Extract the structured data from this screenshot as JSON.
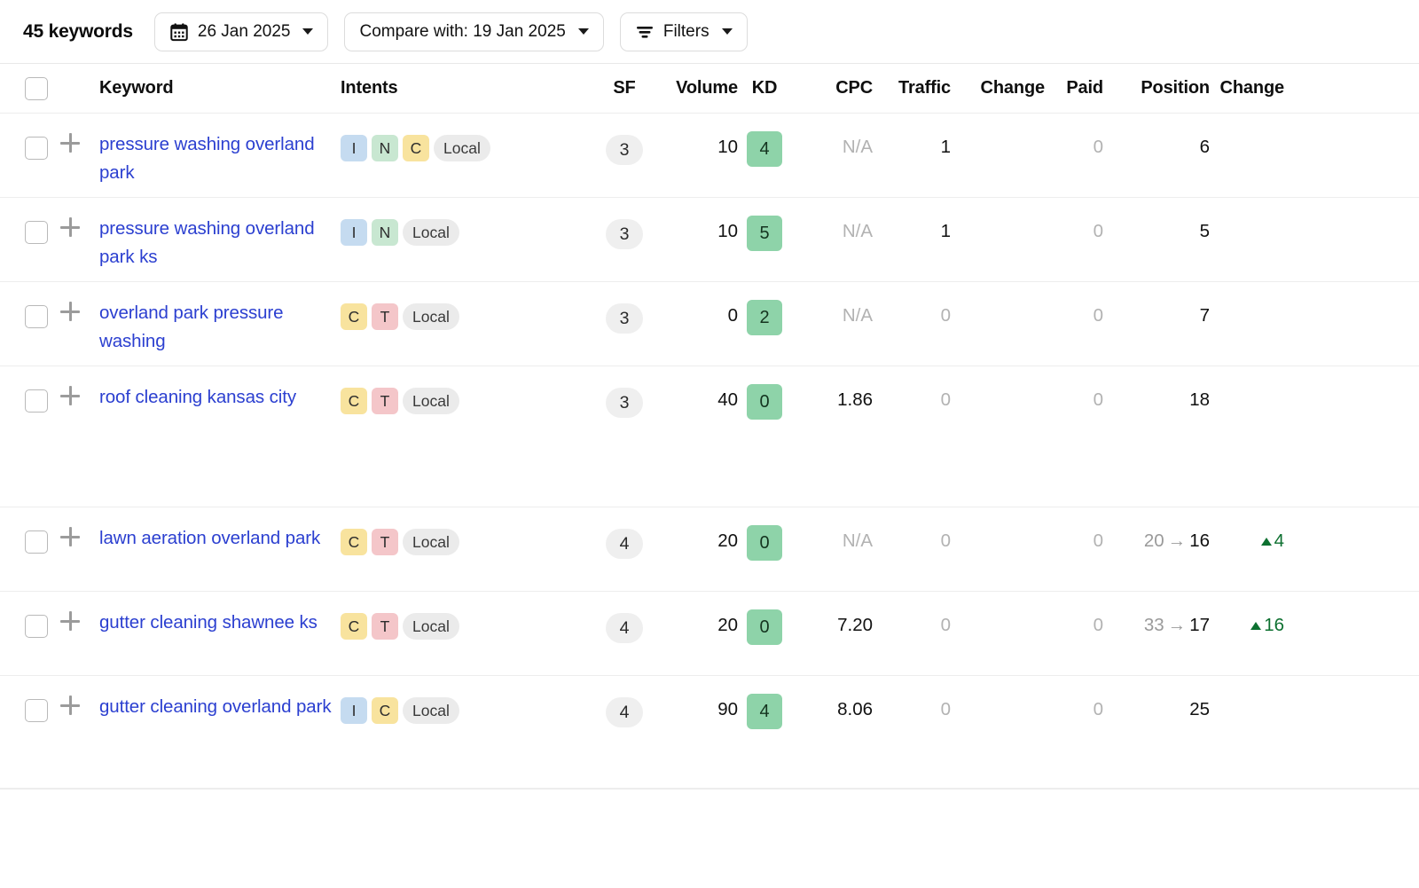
{
  "toolbar": {
    "keyword_count_label": "45 keywords",
    "date_button": {
      "label": "26 Jan 2025",
      "icon": "calendar-icon"
    },
    "compare_button": {
      "label": "Compare with: 19 Jan 2025"
    },
    "filters_button": {
      "label": "Filters",
      "icon": "filter-icon"
    }
  },
  "table": {
    "columns": [
      {
        "key": "keyword",
        "label": "Keyword"
      },
      {
        "key": "intents",
        "label": "Intents"
      },
      {
        "key": "sf",
        "label": "SF"
      },
      {
        "key": "volume",
        "label": "Volume"
      },
      {
        "key": "kd",
        "label": "KD"
      },
      {
        "key": "cpc",
        "label": "CPC"
      },
      {
        "key": "traffic",
        "label": "Traffic"
      },
      {
        "key": "change1",
        "label": "Change"
      },
      {
        "key": "paid",
        "label": "Paid"
      },
      {
        "key": "position",
        "label": "Position"
      },
      {
        "key": "change2",
        "label": "Change"
      }
    ],
    "rows": [
      {
        "keyword": "pressure washing overland park",
        "intents": [
          "I",
          "N",
          "C",
          "Local"
        ],
        "sf": "3",
        "volume": "10",
        "kd": "4",
        "cpc": "N/A",
        "cpc_muted": true,
        "traffic": "1",
        "traffic_muted": false,
        "change1": "",
        "paid": "0",
        "paid_muted": true,
        "position_old": "",
        "position_new": "6",
        "change2": ""
      },
      {
        "keyword": "pressure washing overland park ks",
        "intents": [
          "I",
          "N",
          "Local"
        ],
        "sf": "3",
        "volume": "10",
        "kd": "5",
        "cpc": "N/A",
        "cpc_muted": true,
        "traffic": "1",
        "traffic_muted": false,
        "change1": "",
        "paid": "0",
        "paid_muted": true,
        "position_old": "",
        "position_new": "5",
        "change2": ""
      },
      {
        "keyword": "overland park pressure washing",
        "intents": [
          "C",
          "T",
          "Local"
        ],
        "sf": "3",
        "volume": "0",
        "kd": "2",
        "cpc": "N/A",
        "cpc_muted": true,
        "traffic": "0",
        "traffic_muted": true,
        "change1": "",
        "paid": "0",
        "paid_muted": true,
        "position_old": "",
        "position_new": "7",
        "change2": ""
      },
      {
        "keyword": "roof cleaning kansas city",
        "intents": [
          "C",
          "T",
          "Local"
        ],
        "sf": "3",
        "volume": "40",
        "kd": "0",
        "cpc": "1.86",
        "cpc_muted": false,
        "traffic": "0",
        "traffic_muted": true,
        "change1": "",
        "paid": "0",
        "paid_muted": true,
        "position_old": "",
        "position_new": "18",
        "change2": ""
      },
      {
        "keyword": "lawn aeration overland park",
        "intents": [
          "C",
          "T",
          "Local"
        ],
        "sf": "4",
        "volume": "20",
        "kd": "0",
        "cpc": "N/A",
        "cpc_muted": true,
        "traffic": "0",
        "traffic_muted": true,
        "change1": "",
        "paid": "0",
        "paid_muted": true,
        "position_old": "20",
        "position_new": "16",
        "change2": "4"
      },
      {
        "keyword": "gutter cleaning shawnee ks",
        "intents": [
          "C",
          "T",
          "Local"
        ],
        "sf": "4",
        "volume": "20",
        "kd": "0",
        "cpc": "7.20",
        "cpc_muted": false,
        "traffic": "0",
        "traffic_muted": true,
        "change1": "",
        "paid": "0",
        "paid_muted": true,
        "position_old": "33",
        "position_new": "17",
        "change2": "16"
      },
      {
        "keyword": "gutter cleaning overland park",
        "intents": [
          "I",
          "C",
          "Local"
        ],
        "sf": "4",
        "volume": "90",
        "kd": "4",
        "cpc": "8.06",
        "cpc_muted": false,
        "traffic": "0",
        "traffic_muted": true,
        "change1": "",
        "paid": "0",
        "paid_muted": true,
        "position_old": "",
        "position_new": "25",
        "change2": ""
      }
    ]
  },
  "colors": {
    "link": "#2b3fd0",
    "intent_informational": "#c5dbf0",
    "intent_navigational": "#c8e7d1",
    "intent_commercial": "#f8e39e",
    "intent_transactional": "#f4c6c9",
    "intent_local": "#ebebeb",
    "kd_badge": "#8ed3a9",
    "sf_pill": "#efefef",
    "delta_up": "#0d7030",
    "muted_text": "#b2b2b2"
  },
  "position_arrow_glyph": "→"
}
